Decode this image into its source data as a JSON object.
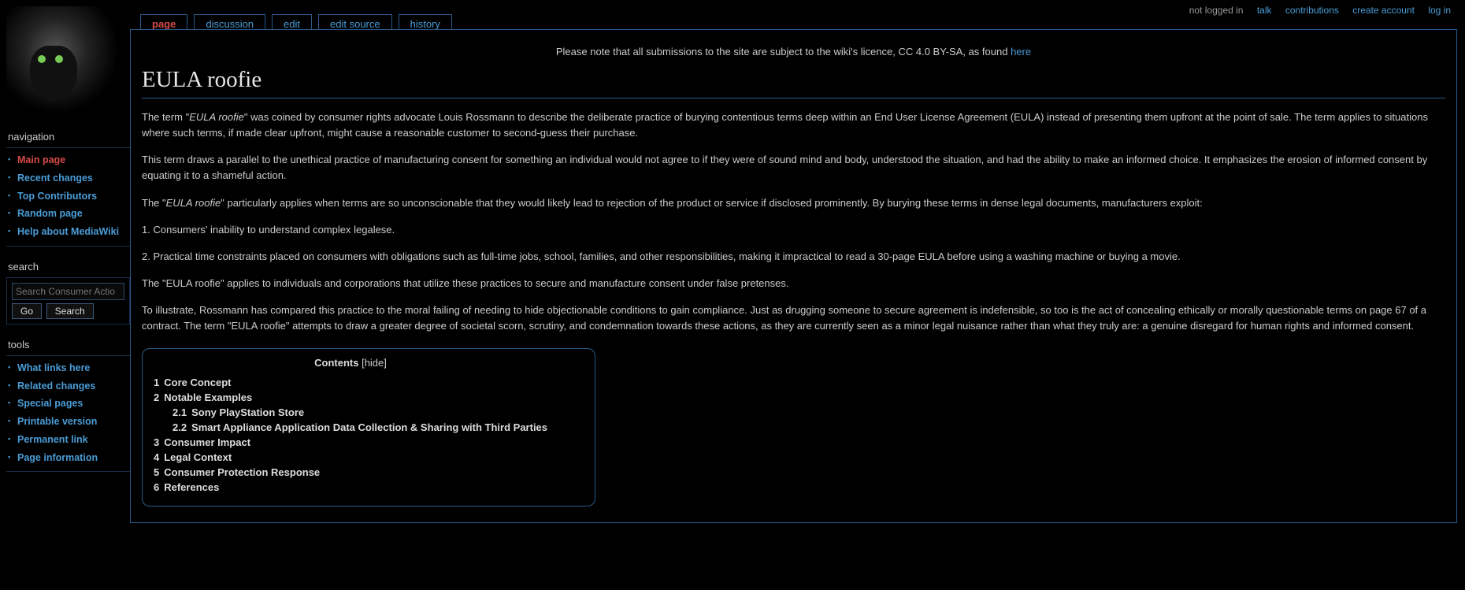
{
  "userlinks": {
    "notlogged": "not logged in",
    "talk": "talk",
    "contributions": "contributions",
    "create": "create account",
    "login": "log in"
  },
  "sidebar": {
    "nav_title": "navigation",
    "nav": [
      {
        "label": "Main page",
        "active": true
      },
      {
        "label": "Recent changes"
      },
      {
        "label": "Top Contributors"
      },
      {
        "label": "Random page"
      },
      {
        "label": "Help about MediaWiki"
      }
    ],
    "search_title": "search",
    "search_placeholder": "Search Consumer Actio",
    "btn_go": "Go",
    "btn_search": "Search",
    "tools_title": "tools",
    "tools": [
      {
        "label": "What links here"
      },
      {
        "label": "Related changes"
      },
      {
        "label": "Special pages"
      },
      {
        "label": "Printable version"
      },
      {
        "label": "Permanent link"
      },
      {
        "label": "Page information"
      }
    ]
  },
  "tabs": [
    {
      "label": "page",
      "active": true
    },
    {
      "label": "discussion"
    },
    {
      "label": "edit"
    },
    {
      "label": "edit source"
    },
    {
      "label": "history"
    }
  ],
  "notice": {
    "text_before": "Please note that all submissions to the site are subject to the wiki's licence, CC 4.0 BY-SA, as found ",
    "link": "here"
  },
  "page_title": "EULA roofie",
  "paragraphs": {
    "p1a": "The term \"",
    "p1em": "EULA roofie",
    "p1b": "\" was coined by consumer rights advocate Louis Rossmann to describe the deliberate practice of burying contentious terms deep within an End User License Agreement (EULA) instead of presenting them upfront at the point of sale. The term applies to situations where such terms, if made clear upfront, might cause a reasonable customer to second-guess their purchase.",
    "p2": "This term draws a parallel to the unethical practice of manufacturing consent for something an individual would not agree to if they were of sound mind and body, understood the situation, and had the ability to make an informed choice. It emphasizes the erosion of informed consent by equating it to a shameful action.",
    "p3a": "The \"",
    "p3em": "EULA roofie",
    "p3b": "\" particularly applies when terms are so unconscionable that they would likely lead to rejection of the product or service if disclosed prominently. By burying these terms in dense legal documents, manufacturers exploit:",
    "p4": "1. Consumers' inability to understand complex legalese.",
    "p5": "2. Practical time constraints placed on consumers with obligations such as full-time jobs, school, families, and other responsibilities, making it impractical to read a 30-page EULA before using a washing machine or buying a movie.",
    "p6": "The \"EULA roofie\" applies to individuals and corporations that utilize these practices to secure and manufacture consent under false pretenses.",
    "p7": "To illustrate, Rossmann has compared this practice to the moral failing of needing to hide objectionable conditions to gain compliance. Just as drugging someone to secure agreement is indefensible, so too is the act of concealing ethically or morally questionable terms on page 67 of a contract. The term \"EULA roofie\" attempts to draw a greater degree of societal scorn, scrutiny, and condemnation towards these actions, as they are currently seen as a minor legal nuisance rather than what they truly are: a genuine disregard for human rights and informed consent."
  },
  "toc": {
    "title": "Contents",
    "hide": "[hide]",
    "items": [
      {
        "num": "1",
        "text": "Core Concept"
      },
      {
        "num": "2",
        "text": "Notable Examples",
        "children": [
          {
            "num": "2.1",
            "text": "Sony PlayStation Store"
          },
          {
            "num": "2.2",
            "text": "Smart Appliance Application Data Collection & Sharing with Third Parties"
          }
        ]
      },
      {
        "num": "3",
        "text": "Consumer Impact"
      },
      {
        "num": "4",
        "text": "Legal Context"
      },
      {
        "num": "5",
        "text": "Consumer Protection Response"
      },
      {
        "num": "6",
        "text": "References"
      }
    ]
  }
}
